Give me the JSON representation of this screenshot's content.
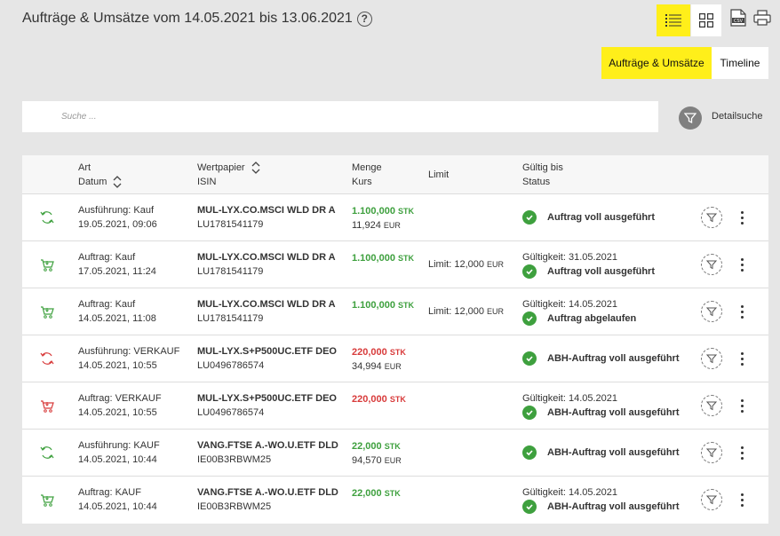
{
  "header": {
    "title": "Aufträge & Umsätze vom 14.05.2021 bis 13.06.2021",
    "help": "?"
  },
  "tabs": [
    {
      "label": "Aufträge & Umsätze",
      "active": true
    },
    {
      "label": "Timeline",
      "active": false
    }
  ],
  "search": {
    "placeholder": "Suche ...",
    "detail_label": "Detailsuche"
  },
  "table": {
    "headers": {
      "art": "Art",
      "datum": "Datum",
      "wertpapier": "Wertpapier",
      "isin": "ISIN",
      "menge": "Menge",
      "kurs": "Kurs",
      "limit": "Limit",
      "gueltig": "Gültig bis",
      "status": "Status"
    },
    "rows": [
      {
        "type": "exec",
        "color": "green",
        "art": "Ausführung: Kauf",
        "datum": "19.05.2021, 09:06",
        "name": "MUL-LYX.CO.MSCI WLD DR A",
        "isin": "LU1781541179",
        "menge": "1.100,000",
        "menge_unit": "STK",
        "kurs": "11,924",
        "kurs_unit": "EUR",
        "limit": "",
        "gueltig": "",
        "status": "Auftrag voll ausgeführt"
      },
      {
        "type": "order",
        "color": "green",
        "art": "Auftrag: Kauf",
        "datum": "17.05.2021, 11:24",
        "name": "MUL-LYX.CO.MSCI WLD DR A",
        "isin": "LU1781541179",
        "menge": "1.100,000",
        "menge_unit": "STK",
        "kurs": "",
        "kurs_unit": "",
        "limit": "Limit: 12,000",
        "limit_unit": "EUR",
        "gueltig": "Gültigkeit: 31.05.2021",
        "status": "Auftrag voll ausgeführt"
      },
      {
        "type": "order",
        "color": "green",
        "art": "Auftrag: Kauf",
        "datum": "14.05.2021, 11:08",
        "name": "MUL-LYX.CO.MSCI WLD DR A",
        "isin": "LU1781541179",
        "menge": "1.100,000",
        "menge_unit": "STK",
        "kurs": "",
        "kurs_unit": "",
        "limit": "Limit: 12,000",
        "limit_unit": "EUR",
        "gueltig": "Gültigkeit: 14.05.2021",
        "status": "Auftrag abgelaufen"
      },
      {
        "type": "exec",
        "color": "red",
        "art": "Ausführung: VERKAUF",
        "datum": "14.05.2021, 10:55",
        "name": "MUL-LYX.S+P500UC.ETF DEO",
        "isin": "LU0496786574",
        "menge": "220,000",
        "menge_unit": "STK",
        "kurs": "34,994",
        "kurs_unit": "EUR",
        "limit": "",
        "gueltig": "",
        "status": "ABH-Auftrag voll ausgeführt"
      },
      {
        "type": "order",
        "color": "red",
        "art": "Auftrag: VERKAUF",
        "datum": "14.05.2021, 10:55",
        "name": "MUL-LYX.S+P500UC.ETF DEO",
        "isin": "LU0496786574",
        "menge": "220,000",
        "menge_unit": "STK",
        "kurs": "",
        "kurs_unit": "",
        "limit": "",
        "gueltig": "Gültigkeit: 14.05.2021",
        "status": "ABH-Auftrag voll ausgeführt"
      },
      {
        "type": "exec",
        "color": "green",
        "art": "Ausführung: KAUF",
        "datum": "14.05.2021, 10:44",
        "name": "VANG.FTSE A.-WO.U.ETF DLD",
        "isin": "IE00B3RBWM25",
        "menge": "22,000",
        "menge_unit": "STK",
        "kurs": "94,570",
        "kurs_unit": "EUR",
        "limit": "",
        "gueltig": "",
        "status": "ABH-Auftrag voll ausgeführt"
      },
      {
        "type": "order",
        "color": "green",
        "art": "Auftrag: KAUF",
        "datum": "14.05.2021, 10:44",
        "name": "VANG.FTSE A.-WO.U.ETF DLD",
        "isin": "IE00B3RBWM25",
        "menge": "22,000",
        "menge_unit": "STK",
        "kurs": "",
        "kurs_unit": "",
        "limit": "",
        "gueltig": "Gültigkeit: 14.05.2021",
        "status": "ABH-Auftrag voll ausgeführt"
      }
    ]
  },
  "colors": {
    "accent": "#ffef1a",
    "buy": "#3ea03e",
    "sell": "#d83b3b"
  }
}
